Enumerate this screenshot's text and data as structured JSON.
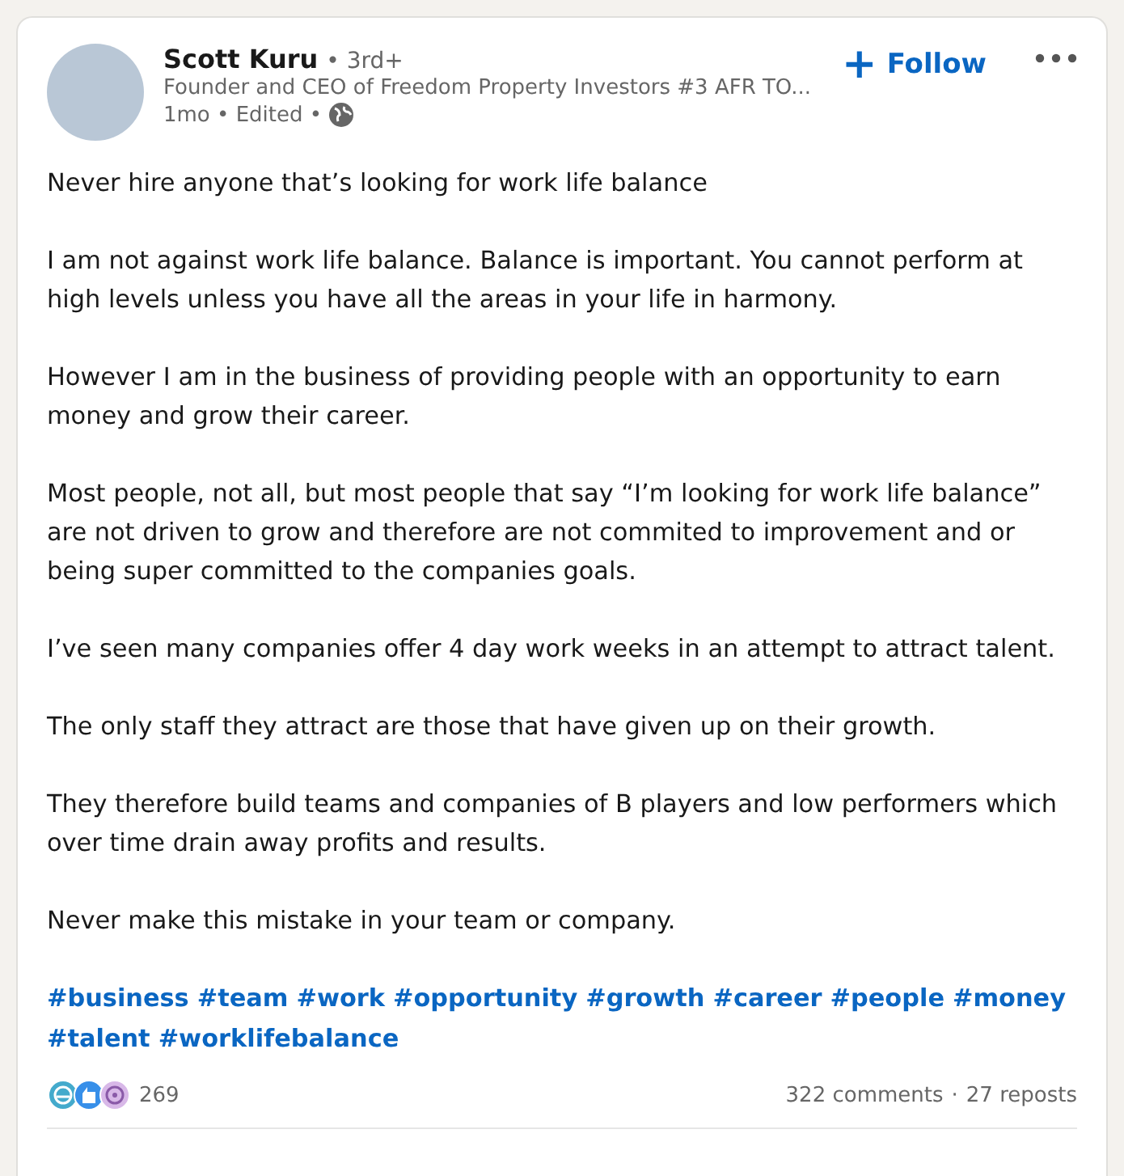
{
  "author": {
    "name": "Scott Kuru",
    "degree": "• 3rd+",
    "headline": "Founder and CEO of Freedom Property Investors #3 AFR TO...",
    "meta": "1mo • Edited •"
  },
  "follow_button": {
    "icon": "+",
    "label": "Follow"
  },
  "paragraphs": [
    "Never hire anyone that’s looking for work life balance",
    "I am not against work life balance. Balance is important. You cannot perform at high levels unless you have all the areas in your life in harmony.",
    "However I am in the business of providing people with an opportunity to earn money and grow their career.",
    "Most people, not all, but most people that say “I’m looking for work life balance” are not driven to grow and therefore are not commited to improvement and or being super committed to the companies goals.",
    "I’ve seen many companies offer 4 day work weeks in an attempt to attract talent.",
    "The only staff they attract are those that have given up on their growth.",
    "They therefore build teams and companies of B players and low performers which over time drain away profits and results.",
    "Never make this mistake in your team or company."
  ],
  "hashtags": [
    "#business",
    "#team",
    "#work",
    "#opportunity",
    "#growth",
    "#career",
    "#people",
    "#money",
    "#talent",
    "#worklifebalance"
  ],
  "social": {
    "reactions": [
      {
        "kind": "funny",
        "color": "#44aacc"
      },
      {
        "kind": "like",
        "color": "#378fe9"
      },
      {
        "kind": "curious",
        "color": "#d8b8e8"
      }
    ],
    "reaction_count": "269",
    "comments": "322 comments",
    "separator": "·",
    "reposts": "27 reposts"
  }
}
